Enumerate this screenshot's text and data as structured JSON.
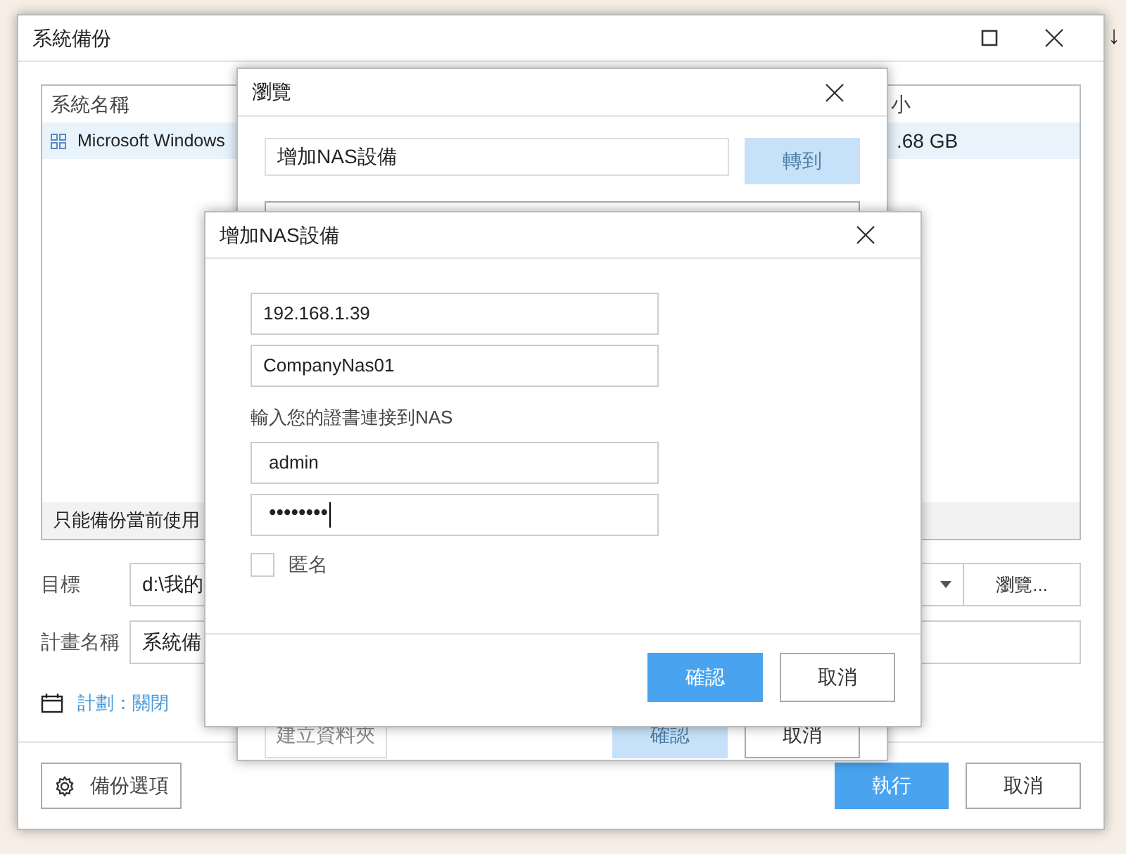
{
  "background": {
    "arrow": "↓"
  },
  "main_window": {
    "title": "系統備份",
    "list": {
      "columns": [
        "系統名稱",
        "小"
      ],
      "rows": [
        {
          "name": "Microsoft Windows",
          "size": ".68 GB",
          "selected": true
        }
      ],
      "footer": "只能備份當前使用"
    },
    "target": {
      "label": "目標",
      "value": "d:\\我的",
      "browse_button": "瀏覽..."
    },
    "plan_name": {
      "label": "計畫名稱",
      "value": "系統備"
    },
    "schedule": "計劃：關閉",
    "buttons": {
      "options": "備份選項",
      "run": "執行",
      "cancel": "取消"
    }
  },
  "browse_dialog": {
    "title": "瀏覽",
    "path": "增加NAS設備",
    "go_button": {
      "label": "轉到",
      "disabled": true
    },
    "buttons": [
      {
        "label": "建立資料夾",
        "disabled": true
      },
      {
        "label": "確認",
        "disabled": true
      },
      {
        "label": "取消",
        "disabled": false
      }
    ]
  },
  "nas_dialog": {
    "title": "增加NAS設備",
    "address": "192.168.1.39",
    "name": "CompanyNas01",
    "credentials_label": "輸入您的證書連接到NAS",
    "username": "admin",
    "password": "••••••••",
    "anonymous": {
      "label": "匿名",
      "checked": false
    },
    "confirm": "確認",
    "cancel": "取消"
  }
}
